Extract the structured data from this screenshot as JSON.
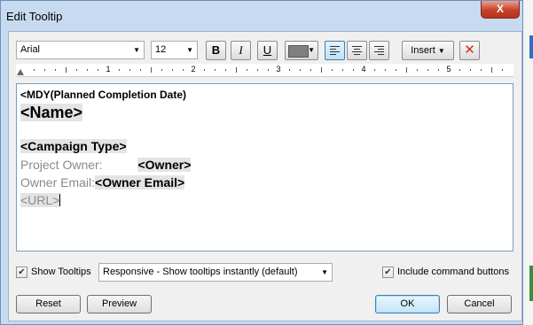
{
  "window": {
    "title": "Edit Tooltip",
    "close_glyph": "X"
  },
  "toolbar": {
    "font": "Arial",
    "size": "12",
    "bold_label": "B",
    "italic_label": "I",
    "underline_label": "U",
    "text_color": "#808080",
    "insert_label": "Insert",
    "clear_glyph": "✕"
  },
  "ruler": {
    "numbers": [
      "1",
      "2",
      "3",
      "4",
      "5"
    ]
  },
  "editor": {
    "line1": "<MDY(Planned Completion Date)",
    "line2": "<Name>",
    "line3": "<Campaign Type>",
    "line4_label": "Project Owner:",
    "line4_field": "<Owner>",
    "line5_label": "Owner Email:",
    "line5_field": "<Owner Email>",
    "line6": "<URL>"
  },
  "options": {
    "show_tooltips_label": "Show Tooltips",
    "show_tooltips_checked": true,
    "mode": "Responsive - Show tooltips instantly (default)",
    "include_commands_label": "Include command buttons",
    "include_commands_checked": true
  },
  "buttons": {
    "reset": "Reset",
    "preview": "Preview",
    "ok": "OK",
    "cancel": "Cancel"
  },
  "colors": {
    "accent": "#3c7fb1",
    "close": "#c8412a",
    "frame": "#c7daf0"
  }
}
